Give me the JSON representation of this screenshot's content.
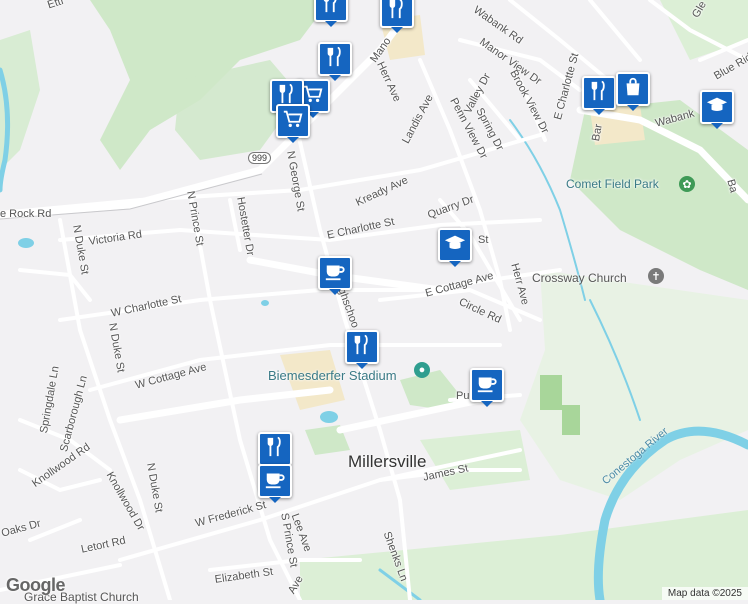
{
  "map": {
    "town_label": "Millersville",
    "places": {
      "comet_field_park": "Comet Field Park",
      "crossway_church": "Crossway Church",
      "biemesderfer_stadium": "Biemesderfer Stadium",
      "grace_baptist": "Grace Baptist Church"
    },
    "river": "Conestoga River",
    "route_shield": "999",
    "streets": {
      "wabank_rd_top": "Wabank Rd",
      "wabank_rd_right": "Wabank",
      "manor": "Mano",
      "manor_view": "Manor View Dr",
      "herr_ave_top": "Herr Ave",
      "landis": "Landis Ave",
      "valley": "Valley Dr",
      "brook_view": "Brook View Dr",
      "penn_view": "Penn View Dr",
      "spring": "Spring Dr",
      "e_charlotte_top": "E Charlotte St",
      "blue_ridge": "Blue Ridg",
      "glen": "Gle",
      "bar": "Bar",
      "ba": "Ba",
      "n_george": "N George St",
      "kready": "Kready Ave",
      "rock": "e Rock Rd",
      "n_prince": "N Prince St",
      "hostetter": "Hostetter Dr",
      "quarry": "Quarry Dr",
      "e_charlotte": "E Charlotte St",
      "st_short": "St",
      "victoria": "Victoria Rd",
      "n_duke_upper": "N Duke St",
      "n_duke_mid": "N Duke St",
      "n_duke_low": "N Duke St",
      "w_charlotte": "W Charlotte St",
      "e_cottage": "E Cottage Ave",
      "highschool": "ighschoo",
      "herr_ave": "Herr Ave",
      "circle": "Circle Rd",
      "w_cottage": "W Cottage Ave",
      "springdale": "Springdale Ln",
      "scarborough": "Scarborough Ln",
      "knollwood_rd": "Knollwood Rd",
      "knollwood_dr": "Knollwood Dr",
      "james": "James St",
      "w_frederick": "W Frederick St",
      "lee": "Lee Ave",
      "s_prince": "S Prince St",
      "oaks": "Oaks Dr",
      "letort": "Letort Rd",
      "shenks": "Shenks Ln",
      "elizabeth": "Elizabeth St",
      "ave_bottom": "Ave",
      "pu": "Pu",
      "ettr": "Ettr"
    },
    "markers": [
      {
        "type": "restaurant",
        "icon": "fork-knife-icon"
      },
      {
        "type": "restaurant",
        "icon": "fork-knife-icon"
      },
      {
        "type": "restaurant",
        "icon": "fork-knife-icon"
      },
      {
        "type": "grocery",
        "icon": "shopping-cart-icon"
      },
      {
        "type": "grocery",
        "icon": "shopping-cart-icon"
      },
      {
        "type": "restaurant",
        "icon": "fork-knife-icon"
      },
      {
        "type": "shopping",
        "icon": "shopping-bag-icon"
      },
      {
        "type": "school",
        "icon": "graduation-cap-icon"
      },
      {
        "type": "school",
        "icon": "graduation-cap-icon"
      },
      {
        "type": "cafe",
        "icon": "coffee-cup-icon"
      },
      {
        "type": "restaurant",
        "icon": "fork-knife-icon"
      },
      {
        "type": "cafe",
        "icon": "coffee-cup-icon"
      },
      {
        "type": "restaurant",
        "icon": "fork-knife-icon"
      },
      {
        "type": "cafe",
        "icon": "coffee-cup-icon"
      }
    ],
    "colors": {
      "background": "#f2f1f3",
      "park": "#cfe8c8",
      "water": "#7fd0e6",
      "road": "#ffffff",
      "marker": "#1565c0"
    }
  },
  "footer": {
    "google": "Google",
    "credit": "Map data ©2025"
  }
}
